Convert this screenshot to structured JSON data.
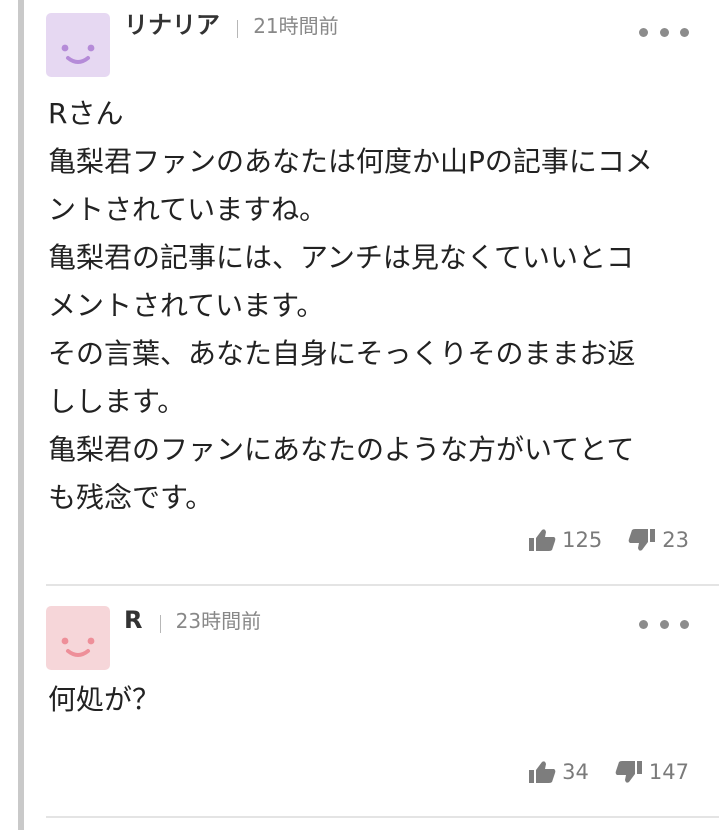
{
  "comments": [
    {
      "username": "リナリア",
      "timestamp": "21時間前",
      "avatar_color": "#e6d8f2",
      "avatar_face_color": "#b58bd8",
      "lines": [
        "Rさん",
        "亀梨君ファンのあなたは何度か山Pの記事にコメ",
        "ントされていますね。",
        "亀梨君の記事には、アンチは見なくていいとコ",
        "メントされています。",
        "その言葉、あなた自身にそっくりそのままお返",
        "しします。",
        "亀梨君のファンにあなたのような方がいてとて",
        "も残念です。"
      ],
      "likes": "125",
      "dislikes": "23"
    },
    {
      "username": "R",
      "timestamp": "23時間前",
      "avatar_color": "#f6d6d9",
      "avatar_face_color": "#ee8f99",
      "lines": [
        "何処が？"
      ],
      "likes": "34",
      "dislikes": "147"
    }
  ],
  "icons": {
    "more": "more-horizontal-icon",
    "like": "thumbs-up-icon",
    "dislike": "thumbs-down-icon",
    "avatar": "smiley-face-icon"
  }
}
